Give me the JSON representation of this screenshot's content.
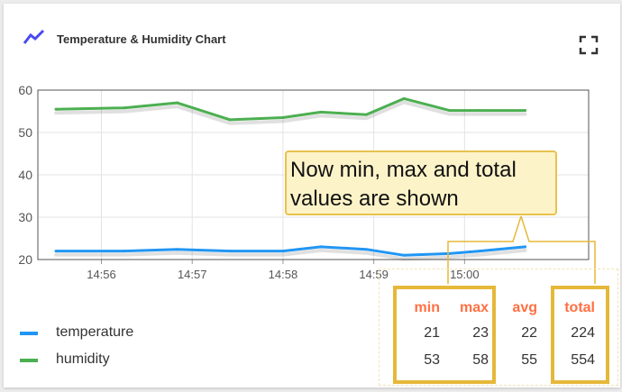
{
  "card": {
    "title": "Temperature & Humidity Chart",
    "title_icon": "timeline-icon",
    "fullscreen_icon": "fullscreen-icon",
    "accent_color": "#4a4af0"
  },
  "chart_data": {
    "type": "line",
    "x": [
      "14:55:30",
      "14:56:15",
      "14:56:50",
      "14:57:25",
      "14:58:00",
      "14:58:25",
      "14:58:55",
      "14:59:20",
      "14:59:50",
      "15:00:10",
      "15:00:40"
    ],
    "series": [
      {
        "name": "temperature",
        "color": "#2196f3",
        "values": [
          22,
          22,
          22.4,
          22,
          22,
          23,
          22.4,
          21,
          21.4,
          22,
          23
        ]
      },
      {
        "name": "humidity",
        "color": "#4caf50",
        "values": [
          55.5,
          55.8,
          57,
          53,
          53.5,
          54.8,
          54.2,
          58,
          55.2,
          55.2,
          55.2
        ]
      }
    ],
    "y_ticks": [
      "20",
      "30",
      "40",
      "50",
      "60"
    ],
    "x_ticks": [
      "14:56",
      "14:57",
      "14:58",
      "14:59",
      "15:00"
    ],
    "ylim": [
      20,
      60
    ],
    "grid": true,
    "legend": "bottom-left"
  },
  "callout": {
    "line1": "Now min, max and total",
    "line2": "values are shown"
  },
  "legend": {
    "headers": {
      "min": "min",
      "max": "max",
      "avg": "avg",
      "total": "total"
    },
    "rows": [
      {
        "name": "temperature",
        "color": "#2196f3",
        "min": "21",
        "max": "23",
        "avg": "22",
        "total": "224"
      },
      {
        "name": "humidity",
        "color": "#4caf50",
        "min": "53",
        "max": "58",
        "avg": "55",
        "total": "554"
      }
    ],
    "highlight_color": "#e6b83a",
    "header_color": "#ff7043"
  }
}
